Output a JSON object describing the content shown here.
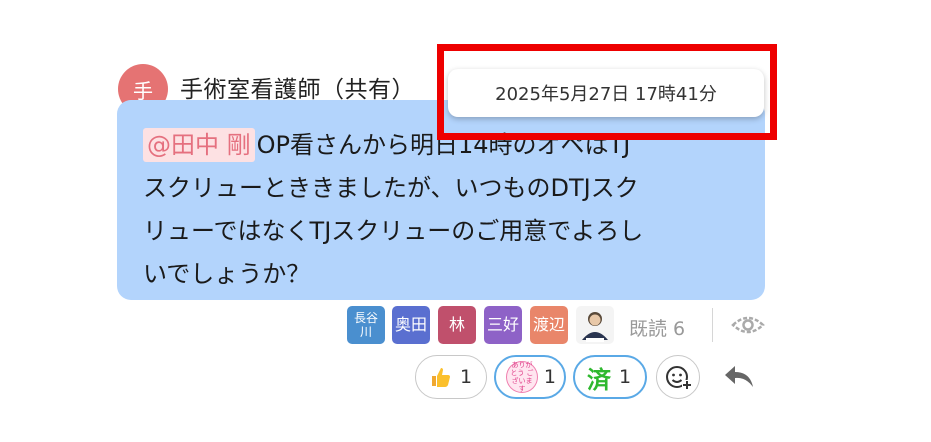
{
  "message": {
    "avatar_text": "手",
    "sender": "手術室看護師（共有）",
    "mention": "@田中 剛",
    "lines": [
      "OP看さんから明日14時のオペはTJ",
      "スクリューとききましたが、いつものDTJスク",
      "リューではなくTJスクリューのご用意でよろし",
      "いでしょうか？"
    ]
  },
  "tooltip": {
    "timestamp": "2025年5月27日 17時41分"
  },
  "readers": [
    {
      "label": "長谷川",
      "color": "#4a8fcf"
    },
    {
      "label": "奥田",
      "color": "#5a6fd0"
    },
    {
      "label": "林",
      "color": "#c0506c"
    },
    {
      "label": "三好",
      "color": "#8e62c7"
    },
    {
      "label": "渡辺",
      "color": "#e9866a"
    },
    {
      "label": "",
      "color": "#ffffff"
    }
  ],
  "read_status": "既読 6",
  "reactions": [
    {
      "icon": "thumbs-up-icon",
      "count": "1"
    },
    {
      "icon": "arigatou-stamp-icon",
      "stamp_text": "ありがとう ございます",
      "count": "1"
    },
    {
      "icon": "done-stamp-icon",
      "stamp_text": "済",
      "count": "1"
    }
  ],
  "colors": {
    "bubble": "#b3d4fc",
    "mention_bg": "#fde1e3",
    "mention_text": "#e5707f",
    "highlight": "#ee0000",
    "avatar": "#e57373"
  }
}
